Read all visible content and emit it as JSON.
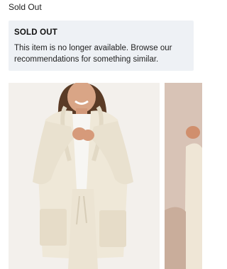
{
  "status": {
    "label": "Sold Out"
  },
  "notice": {
    "title": "SOLD OUT",
    "message": "This item is no longer available. Browse our recommendations for something similar."
  },
  "carousel": {
    "images": [
      {
        "icon": "product-photo-model-cardigan"
      },
      {
        "icon": "product-photo-next-partial"
      }
    ]
  },
  "colors": {
    "banner_bg": "#eef1f5",
    "photo_bg_main": "#f3f0ec",
    "photo_bg_next": "#d8c3b6",
    "cardigan": "#efe8d8"
  }
}
